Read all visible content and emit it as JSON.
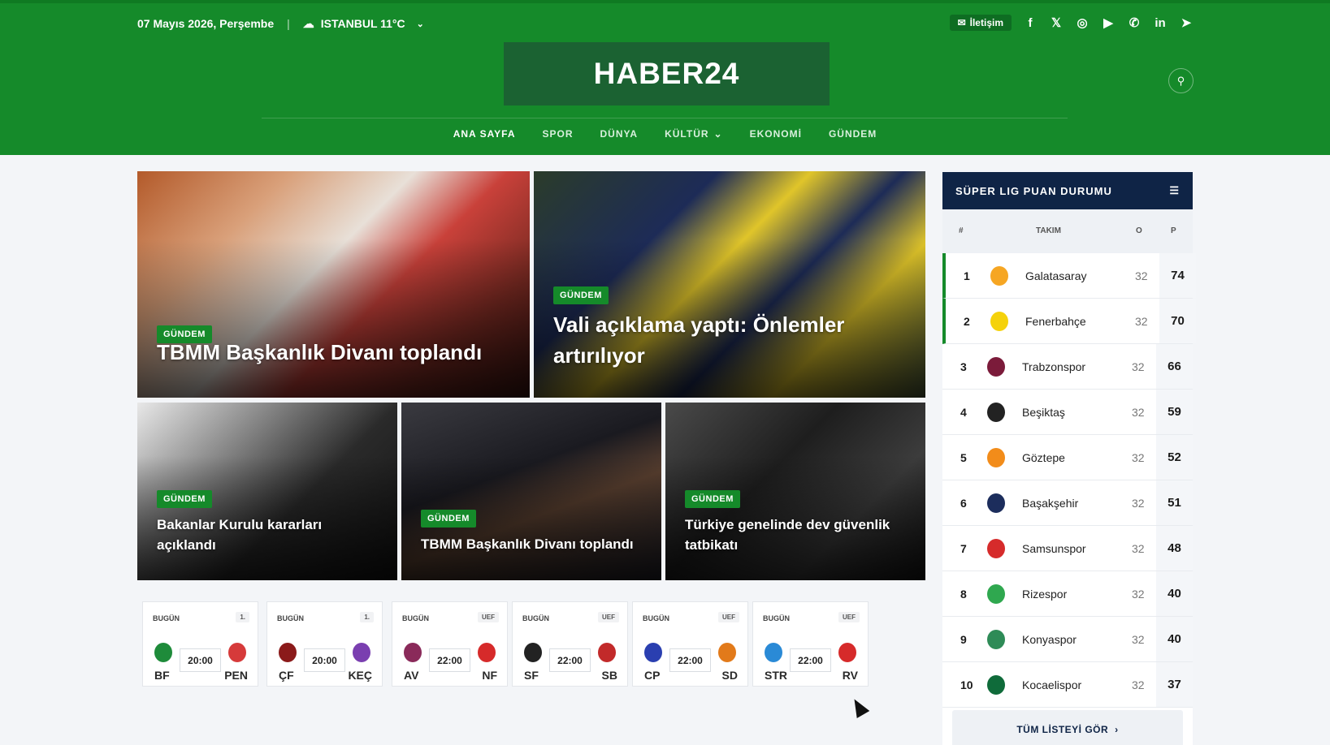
{
  "topbar": {
    "date": "07 Mayıs 2026, Perşembe",
    "weather": "ISTANBUL 11°C",
    "contact": "İletişim",
    "socials": [
      "facebook-icon",
      "x-icon",
      "instagram-icon",
      "youtube-icon",
      "whatsapp-icon",
      "linkedin-icon",
      "telegram-icon"
    ]
  },
  "logo": "HABER24",
  "nav": {
    "items": [
      {
        "label": "ANA SAYFA"
      },
      {
        "label": "SPOR"
      },
      {
        "label": "DÜNYA"
      },
      {
        "label": "KÜLTÜR"
      },
      {
        "label": "EKONOMİ"
      },
      {
        "label": "GÜNDEM"
      }
    ]
  },
  "news": [
    {
      "category": "GÜNDEM",
      "title": "TBMM Başkanlık Divanı toplandı"
    },
    {
      "category": "GÜNDEM",
      "title": "Vali açıklama yaptı: Önlemler artırılıyor"
    },
    {
      "category": "GÜNDEM",
      "title": "Bakanlar Kurulu kararları açıklandı"
    },
    {
      "category": "GÜNDEM",
      "title": "TBMM Başkanlık Divanı toplandı"
    },
    {
      "category": "GÜNDEM",
      "title": "Türkiye genelinde dev güvenlik tatbikatı"
    }
  ],
  "matches": [
    {
      "date": "BUGÜN",
      "comp": "1.",
      "time": "20:00",
      "home": "BF",
      "away": "PEN"
    },
    {
      "date": "BUGÜN",
      "comp": "1.",
      "time": "20:00",
      "home": "ÇF",
      "away": "KEÇ"
    },
    {
      "date": "BUGÜN",
      "comp": "UEF",
      "time": "22:00",
      "home": "AV",
      "away": "NF"
    },
    {
      "date": "BUGÜN",
      "comp": "UEF",
      "time": "22:00",
      "home": "SF",
      "away": "SB"
    },
    {
      "date": "BUGÜN",
      "comp": "UEF",
      "time": "22:00",
      "home": "CP",
      "away": "SD"
    },
    {
      "date": "BUGÜN",
      "comp": "UEF",
      "time": "22:00",
      "home": "STR",
      "away": "RV"
    }
  ],
  "standings": {
    "title": "SÜPER LIG PUAN DURUMU",
    "cols": {
      "rank": "#",
      "team": "TAKIM",
      "played": "O",
      "points": "P"
    },
    "rows": [
      {
        "rank": "1",
        "team": "Galatasaray",
        "played": "32",
        "points": "74",
        "color": "#f6a623"
      },
      {
        "rank": "2",
        "team": "Fenerbahçe",
        "played": "32",
        "points": "70",
        "color": "#f5d20b"
      },
      {
        "rank": "3",
        "team": "Trabzonspor",
        "played": "32",
        "points": "66",
        "color": "#7b1b3a"
      },
      {
        "rank": "4",
        "team": "Beşiktaş",
        "played": "32",
        "points": "59",
        "color": "#222222"
      },
      {
        "rank": "5",
        "team": "Göztepe",
        "played": "32",
        "points": "52",
        "color": "#f28c1a"
      },
      {
        "rank": "6",
        "team": "Başakşehir",
        "played": "32",
        "points": "51",
        "color": "#1c2d5c"
      },
      {
        "rank": "7",
        "team": "Samsunspor",
        "played": "32",
        "points": "48",
        "color": "#d62b2b"
      },
      {
        "rank": "8",
        "team": "Rizespor",
        "played": "32",
        "points": "40",
        "color": "#2fa84f"
      },
      {
        "rank": "9",
        "team": "Konyaspor",
        "played": "32",
        "points": "40",
        "color": "#2e8b57"
      },
      {
        "rank": "10",
        "team": "Kocaelispor",
        "played": "32",
        "points": "37",
        "color": "#0f6b3a"
      }
    ],
    "see_all": "TÜM LİSTEYİ GÖR"
  }
}
